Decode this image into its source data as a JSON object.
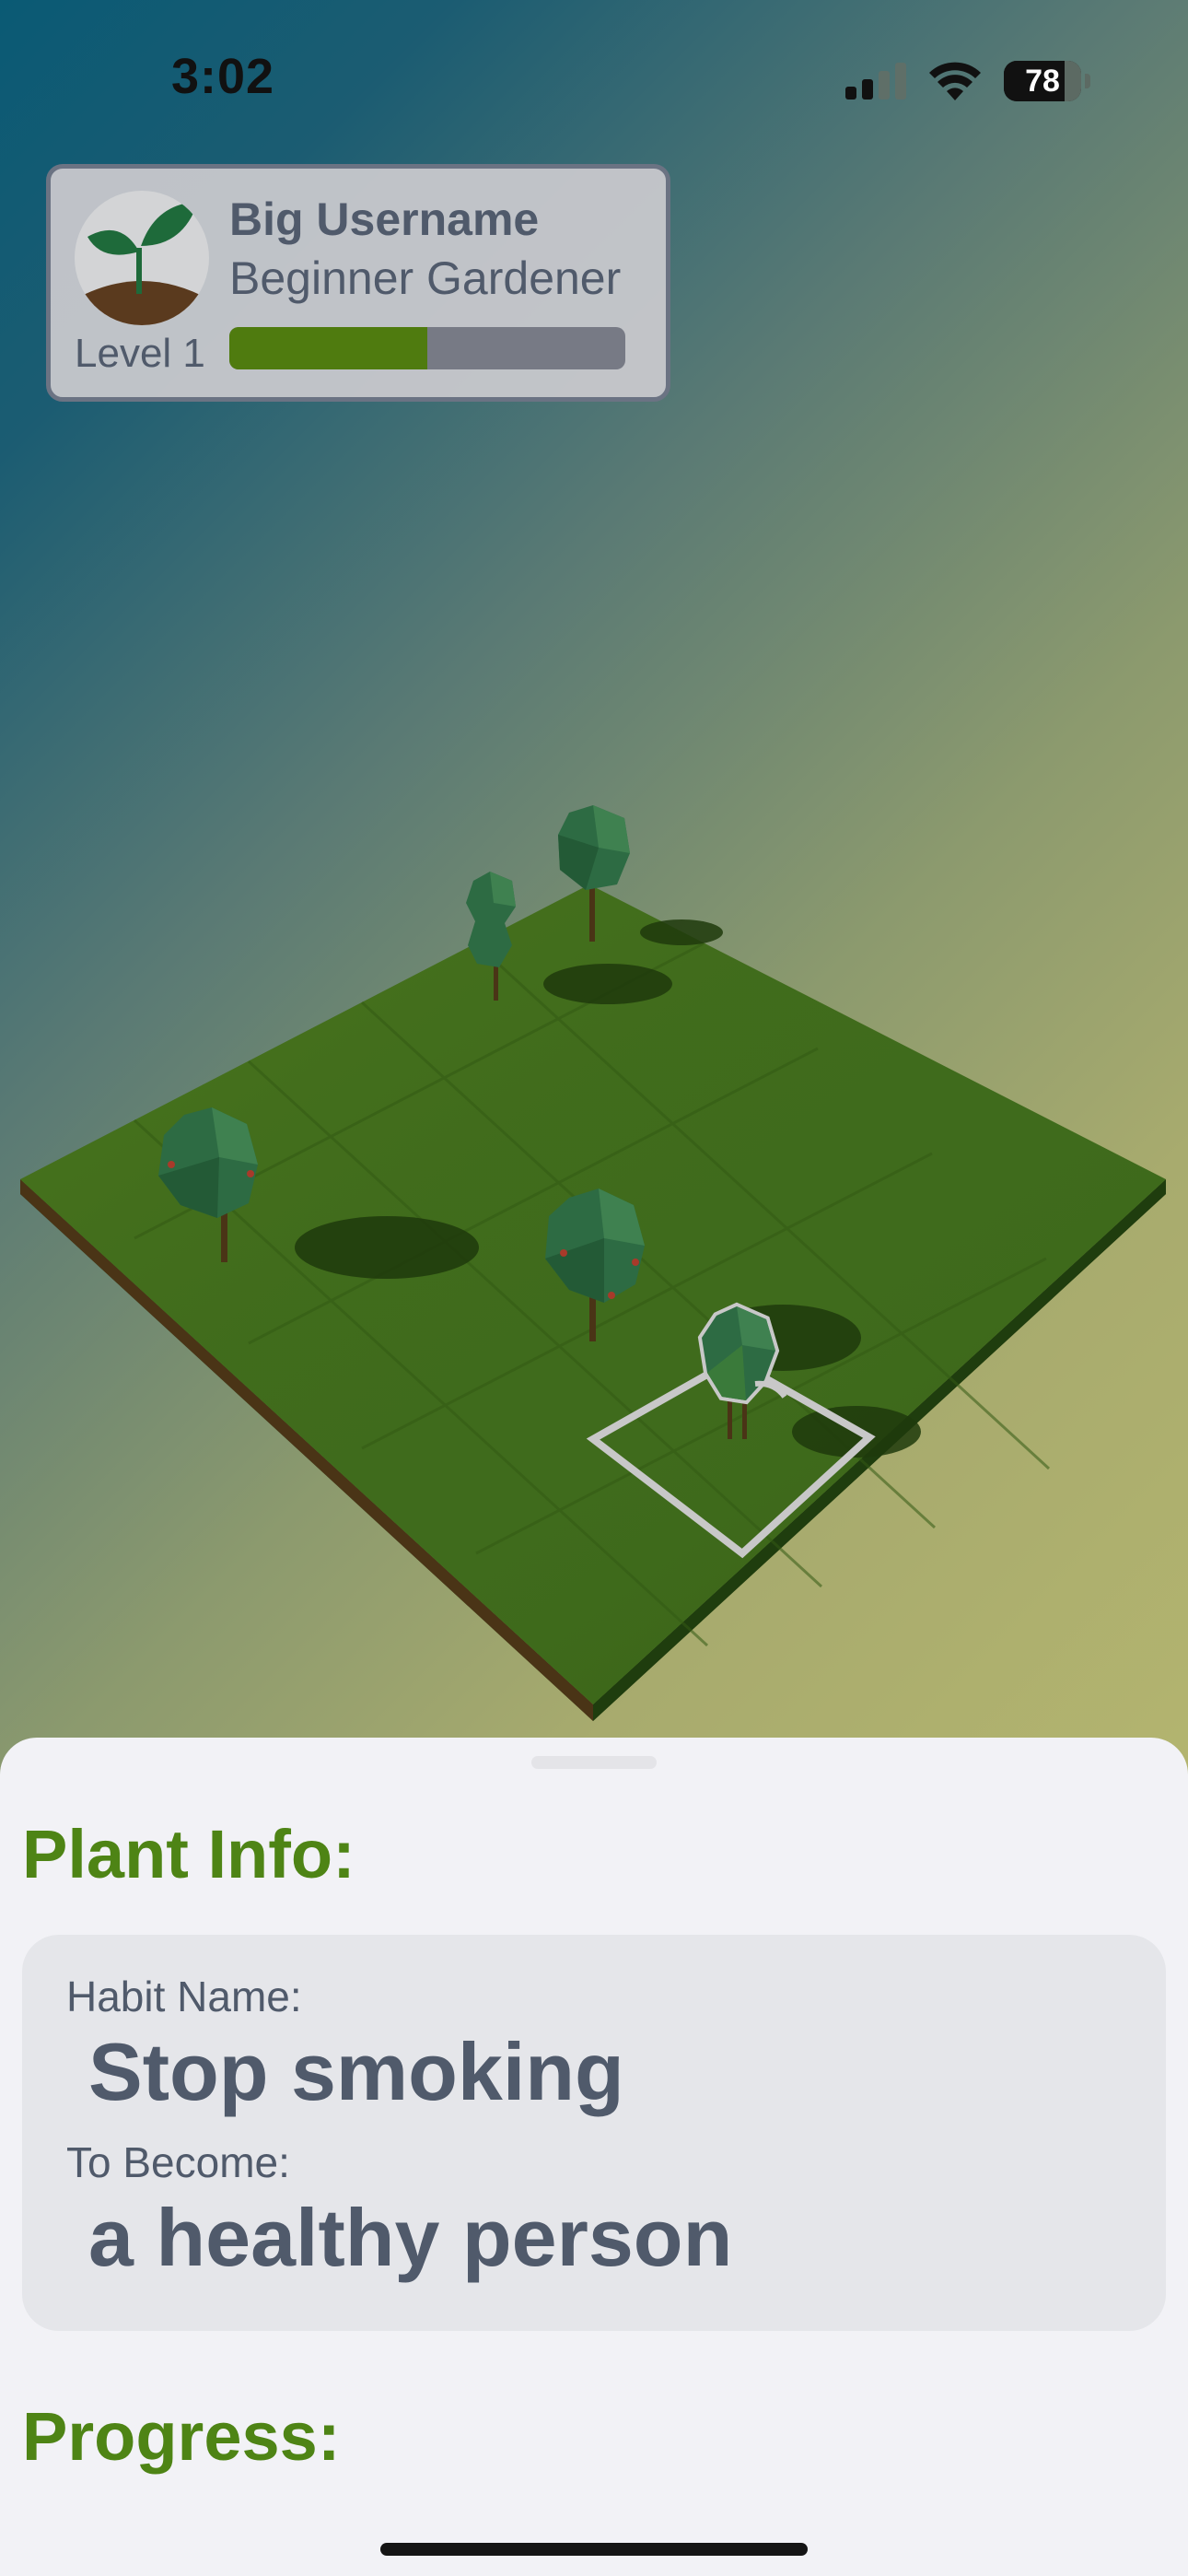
{
  "status_bar": {
    "time": "3:02",
    "battery": "78",
    "icons": [
      "cellular-signal-icon",
      "wifi-icon",
      "battery-icon"
    ]
  },
  "profile": {
    "username": "Big Username",
    "rank": "Beginner Gardener",
    "level": "Level 1",
    "xp_progress": 0.5,
    "avatar_icon": "sprout-icon"
  },
  "garden": {
    "plants": [
      "tree",
      "tree",
      "tree",
      "tree",
      "tree"
    ],
    "selected_plant": "tree",
    "colors": {
      "grass": "#3f6b1c",
      "foliage": "#2e6b45",
      "selection": "#c8c8c8"
    }
  },
  "plant_info": {
    "heading": "Plant Info:",
    "habit_label": "Habit Name:",
    "habit_value": "Stop smoking",
    "become_label": "To Become:",
    "become_value": "a healthy person"
  },
  "progress": {
    "heading": "Progress:"
  },
  "colors": {
    "accent": "#4e8415",
    "text": "#505a6b",
    "sheet_bg": "#f2f2f6"
  }
}
